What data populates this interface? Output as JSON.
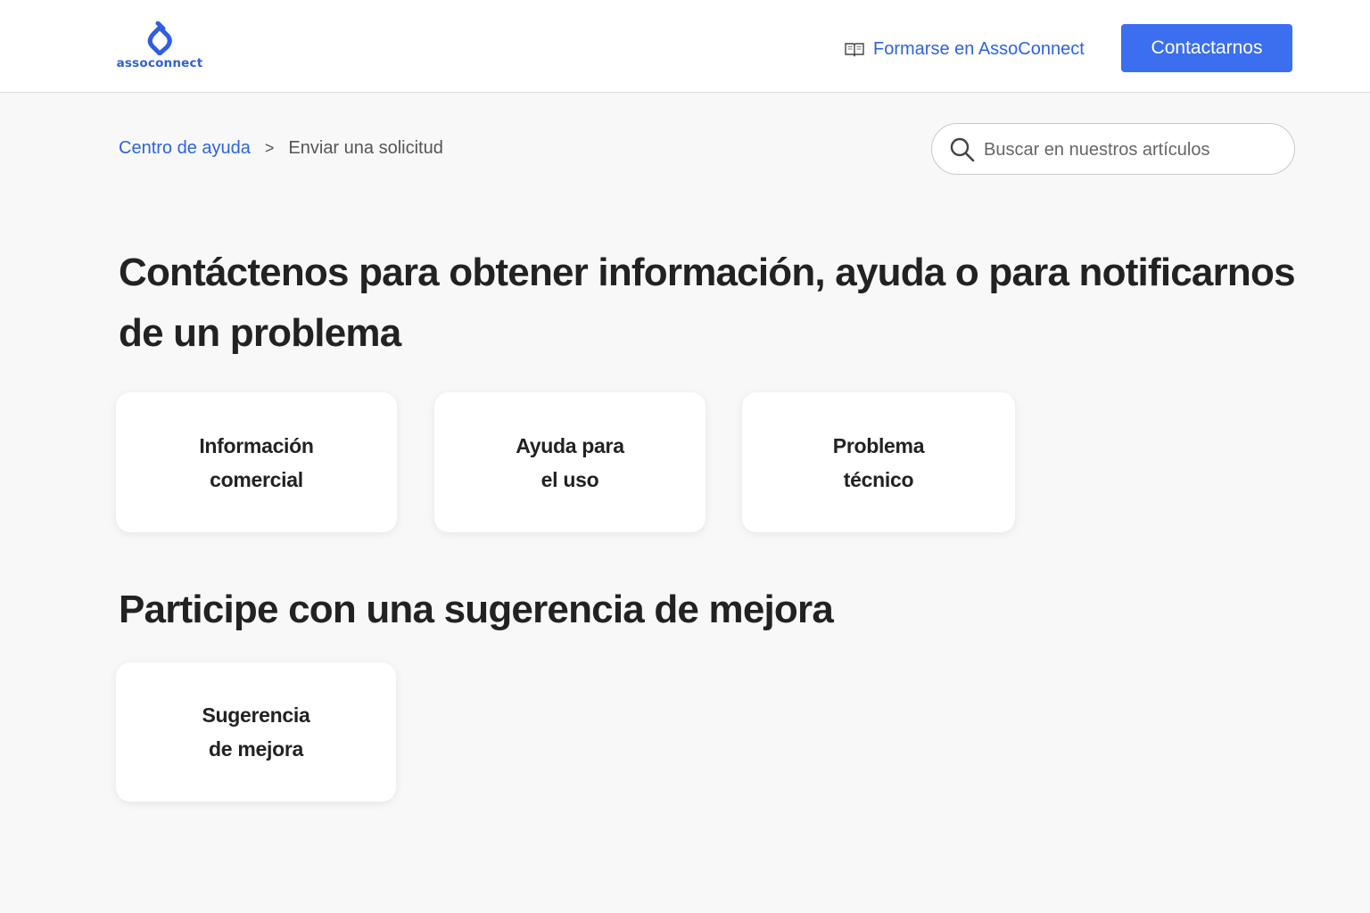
{
  "header": {
    "logo_text": "assoconnect",
    "training_link": "Formarse en AssoConnect",
    "contact_button": "Contactarnos",
    "colors": {
      "accent": "#2d63e1",
      "button": "#3b6ff0"
    },
    "icons": [
      "logo-icon",
      "book-icon"
    ]
  },
  "breadcrumb": {
    "home": "Centro de ayuda",
    "separator": ">",
    "current": "Enviar una solicitud"
  },
  "search": {
    "placeholder": "Buscar en nuestros artículos",
    "value": "",
    "icon": "search-icon"
  },
  "main": {
    "contact_heading": "Contáctenos para obtener información, ayuda o para notificarnos de un problema",
    "contact_cards": [
      {
        "label": "Información\ncomercial"
      },
      {
        "label": "Ayuda para\nel uso"
      },
      {
        "label": "Problema\ntécnico"
      }
    ],
    "suggest_heading": "Participe con una sugerencia de mejora",
    "suggest_cards": [
      {
        "label": "Sugerencia\nde mejora"
      }
    ]
  }
}
